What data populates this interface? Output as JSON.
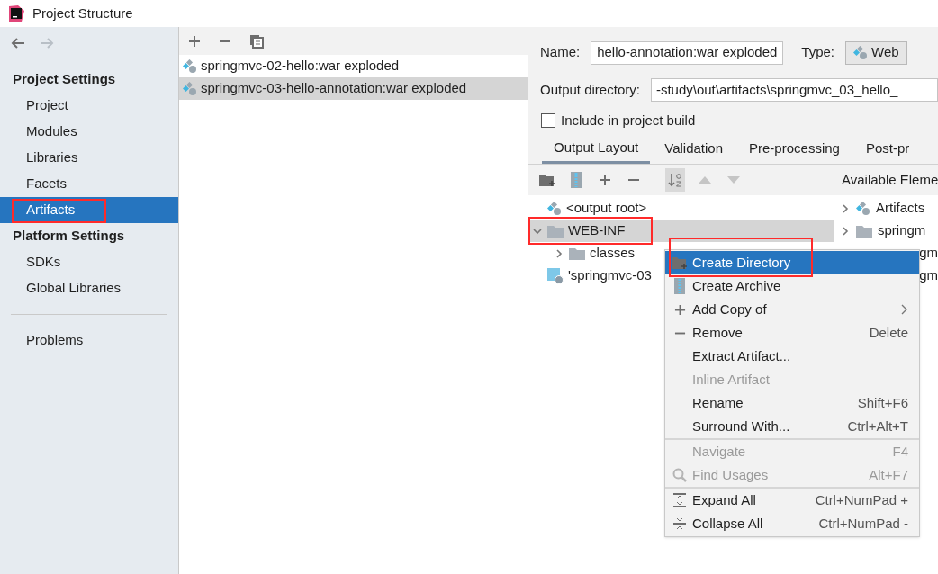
{
  "window": {
    "title": "Project Structure"
  },
  "sidebar": {
    "sections": [
      {
        "title": "Project Settings",
        "items": [
          {
            "label": "Project",
            "selected": false,
            "highlighted": false
          },
          {
            "label": "Modules",
            "selected": false,
            "highlighted": false
          },
          {
            "label": "Libraries",
            "selected": false,
            "highlighted": false
          },
          {
            "label": "Facets",
            "selected": false,
            "highlighted": false
          },
          {
            "label": "Artifacts",
            "selected": true,
            "highlighted": true
          }
        ]
      },
      {
        "title": "Platform Settings",
        "items": [
          {
            "label": "SDKs",
            "selected": false,
            "highlighted": false
          },
          {
            "label": "Global Libraries",
            "selected": false,
            "highlighted": false
          }
        ]
      }
    ],
    "bottom_items": [
      {
        "label": "Problems",
        "selected": false,
        "highlighted": false
      }
    ]
  },
  "artifacts_list": {
    "items": [
      {
        "label": "springmvc-02-hello:war exploded",
        "selected": false
      },
      {
        "label": "springmvc-03-hello-annotation:war exploded",
        "selected": true
      }
    ]
  },
  "editor": {
    "name_label": "Name:",
    "name_value": "hello-annotation:war exploded",
    "type_label": "Type:",
    "type_value": "Web",
    "output_label": "Output directory:",
    "output_value": "-study\\out\\artifacts\\springmvc_03_hello_",
    "include_checkbox": {
      "label": "Include in project build",
      "checked": false
    },
    "tabs": [
      {
        "label": "Output Layout",
        "selected": true
      },
      {
        "label": "Validation",
        "selected": false
      },
      {
        "label": "Pre-processing",
        "selected": false
      },
      {
        "label": "Post-pr",
        "selected": false
      }
    ],
    "layout_toolbar": [
      {
        "kind": "new-folder",
        "disabled": false,
        "selected": false
      },
      {
        "kind": "archive",
        "disabled": false,
        "selected": false
      },
      {
        "kind": "add",
        "disabled": false,
        "selected": false
      },
      {
        "kind": "remove",
        "disabled": false,
        "selected": false
      },
      {
        "kind": "sort",
        "disabled": false,
        "selected": true
      },
      {
        "kind": "up",
        "disabled": true,
        "selected": false
      },
      {
        "kind": "down",
        "disabled": true,
        "selected": false
      }
    ],
    "tree": [
      {
        "label": "<output root>",
        "kind": "artifact",
        "selected": false,
        "highlighted": false
      },
      {
        "label": "WEB-INF",
        "kind": "folder",
        "expanded": true,
        "selected": true,
        "highlighted": true,
        "children": [
          {
            "label": "classes",
            "kind": "folder",
            "expanded": false,
            "selected": false,
            "highlighted": false
          }
        ]
      },
      {
        "label": "'springmvc-03",
        "kind": "module",
        "selected": false,
        "highlighted": false
      }
    ],
    "available": {
      "title": "Available Eleme",
      "items": [
        {
          "label": "Artifacts",
          "kind": "artifact"
        },
        {
          "label": "springm",
          "kind": "folder"
        },
        {
          "label": "gm",
          "kind": "clipped"
        },
        {
          "label": "gm",
          "kind": "clipped"
        }
      ]
    }
  },
  "context_menu": {
    "groups": [
      [
        {
          "label": "Create Directory",
          "selected": true,
          "highlighted": true,
          "disabled": false
        },
        {
          "label": "Create Archive",
          "selected": false,
          "highlighted": false,
          "disabled": false
        },
        {
          "label": "Add Copy of",
          "submenu": true,
          "selected": false,
          "highlighted": false,
          "disabled": false
        },
        {
          "label": "Remove",
          "shortcut": "Delete",
          "selected": false,
          "highlighted": false,
          "disabled": false
        },
        {
          "label": "Extract Artifact...",
          "selected": false,
          "highlighted": false,
          "disabled": false
        },
        {
          "label": "Inline Artifact",
          "selected": false,
          "highlighted": false,
          "disabled": true
        },
        {
          "label": "Rename",
          "shortcut": "Shift+F6",
          "selected": false,
          "highlighted": false,
          "disabled": false
        },
        {
          "label": "Surround With...",
          "shortcut": "Ctrl+Alt+T",
          "selected": false,
          "highlighted": false,
          "disabled": false
        }
      ],
      [
        {
          "label": "Navigate",
          "shortcut": "F4",
          "selected": false,
          "highlighted": false,
          "disabled": true
        },
        {
          "label": "Find Usages",
          "shortcut": "Alt+F7",
          "selected": false,
          "highlighted": false,
          "disabled": true
        }
      ],
      [
        {
          "label": "Expand All",
          "shortcut": "Ctrl+NumPad +",
          "selected": false,
          "highlighted": false,
          "disabled": false
        },
        {
          "label": "Collapse All",
          "shortcut": "Ctrl+NumPad -",
          "selected": false,
          "highlighted": false,
          "disabled": false
        }
      ]
    ]
  }
}
